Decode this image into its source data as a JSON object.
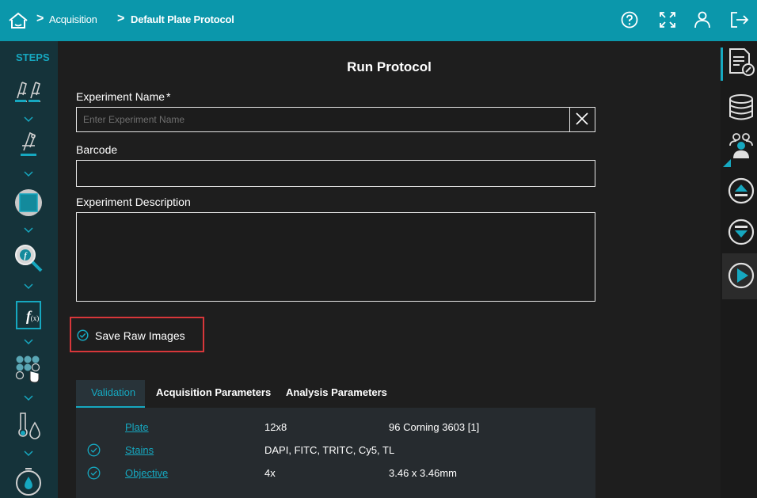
{
  "breadcrumb": {
    "items": [
      "Acquisition",
      "Default Plate Protocol"
    ]
  },
  "icons": {
    "home": "home-icon",
    "help": "help-icon",
    "fullscreen": "fullscreen-icon",
    "user": "user-icon",
    "logout": "logout-icon"
  },
  "sidebar": {
    "title": "STEPS",
    "steps": [
      "microscope-pair-icon",
      "microscope-icon",
      "roi-square-icon",
      "function-search-icon",
      "function-icon",
      "wells-pointer-icon",
      "thermometer-drop-icon",
      "timer-icon"
    ]
  },
  "page": {
    "title": "Run Protocol"
  },
  "form": {
    "experiment_name_label": "Experiment Name",
    "required_mark": "*",
    "experiment_name_placeholder": "Enter Experiment Name",
    "experiment_name_value": "",
    "barcode_label": "Barcode",
    "barcode_value": "",
    "description_label": "Experiment Description",
    "description_value": ""
  },
  "save_raw_images": {
    "label": "Save Raw Images",
    "checked": true
  },
  "tabs": [
    "Validation",
    "Acquisition Parameters",
    "Analysis Parameters"
  ],
  "active_tab": "Validation",
  "validation_rows": [
    {
      "name": "Plate",
      "value": "12x8",
      "detail": "96 Corning 3603 [1]",
      "checked": false
    },
    {
      "name": "Stains",
      "value": "DAPI, FITC, TRITC, Cy5, TL",
      "detail": "",
      "checked": true
    },
    {
      "name": "Objective",
      "value": "4x",
      "detail": "3.46 x 3.46mm",
      "checked": true
    }
  ],
  "right_sidebar": [
    "protocol-edit-icon",
    "database-icon",
    "users-icon",
    "eject-up-icon",
    "eject-down-icon",
    "play-icon"
  ],
  "colors": {
    "accent": "#0b97ab",
    "accent_text": "#16a8c0",
    "highlight_border": "#d8373a",
    "background": "#1e1e1e"
  }
}
